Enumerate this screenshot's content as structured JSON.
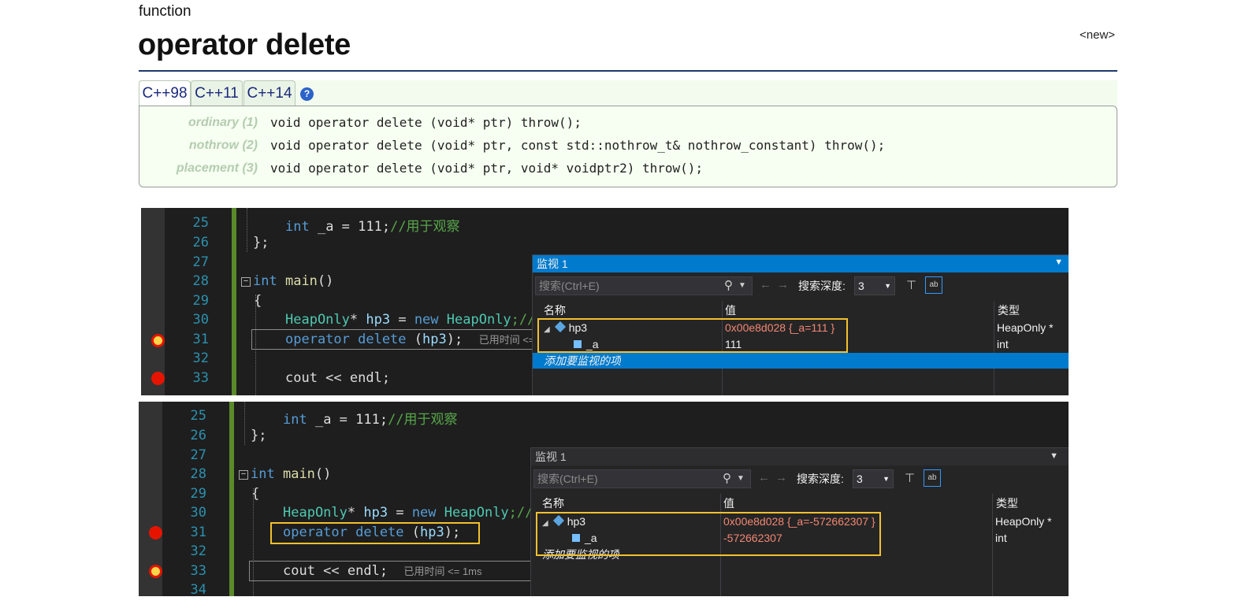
{
  "ref": {
    "kind": "function",
    "title": "operator delete",
    "header_link": "<new>",
    "tabs": [
      "C++98",
      "C++11",
      "C++14"
    ],
    "help_icon": "?",
    "prototypes": [
      {
        "label": "ordinary (1)",
        "code": "void operator delete (void* ptr) throw();"
      },
      {
        "label": "nothrow (2)",
        "code": "void operator delete (void* ptr, const std::nothrow_t& nothrow_constant) throw();"
      },
      {
        "label": "placement (3)",
        "code": "void operator delete (void* ptr, void* voidptr2) throw();"
      }
    ]
  },
  "debug_top": {
    "lines": [
      "25",
      "26",
      "27",
      "28",
      "29",
      "30",
      "31",
      "32",
      "33"
    ],
    "code_25_type": "int",
    "code_25_rest": " _a = 111;",
    "code_25_comment": "//用于观察",
    "code_26": "};",
    "code_28_type": "int",
    "code_28_fn": "main",
    "code_28_rest": "()",
    "code_29": "{",
    "code_30_type": "HeapOnly",
    "code_30_a": "* ",
    "code_30_var": "hp3",
    "code_30_b": " = ",
    "code_30_kw": "new",
    "code_30_c": " ",
    "code_30_type2": "HeapOnly",
    "code_30_d": ";//",
    "code_31_kw": "operator delete",
    "code_31_rest": " (",
    "code_31_var": "hp3",
    "code_31_end": ");",
    "code_31_elapsed": "已用时间 <=",
    "code_33": "cout << endl;"
  },
  "debug_bottom": {
    "lines": [
      "25",
      "26",
      "27",
      "28",
      "29",
      "30",
      "31",
      "32",
      "33",
      "34"
    ],
    "code_33_elapsed": "已用时间 <= 1ms"
  },
  "watch": {
    "title": "监视 1",
    "search_placeholder": "搜索(Ctrl+E)",
    "depth_label": "搜索深度:",
    "depth_value": "3",
    "col_name": "名称",
    "col_value": "值",
    "col_type": "类型",
    "add_item": "添加要监视的项",
    "top": {
      "row1_name": "hp3",
      "row1_value": "0x00e8d028 {_a=111 }",
      "row1_type": "HeapOnly *",
      "row2_name": "_a",
      "row2_value": "111",
      "row2_type": "int"
    },
    "bottom": {
      "row1_name": "hp3",
      "row1_value": "0x00e8d028 {_a=-572662307 }",
      "row1_type": "HeapOnly *",
      "row2_name": "_a",
      "row2_value": "-572662307",
      "row2_type": "int"
    }
  }
}
